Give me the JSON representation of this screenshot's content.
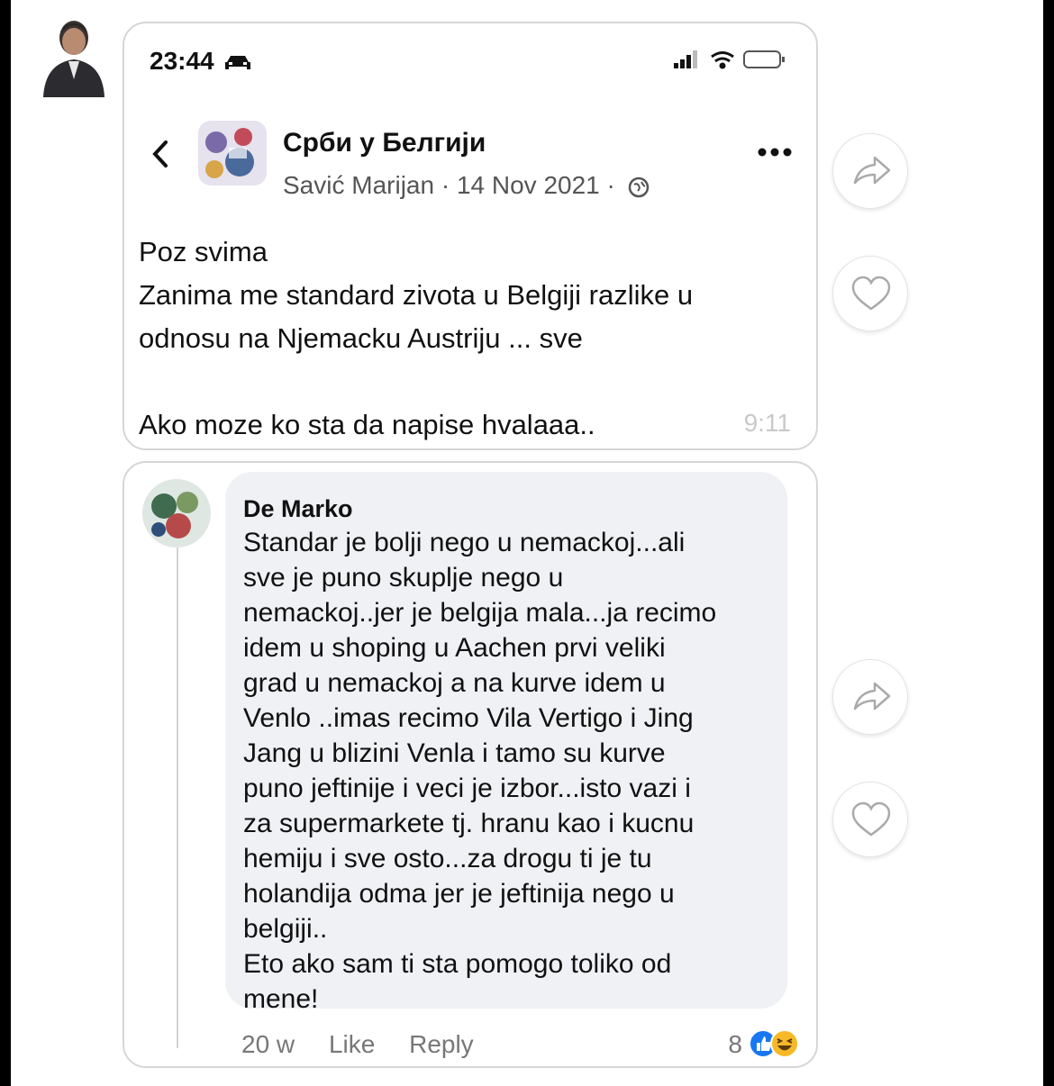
{
  "status_bar": {
    "time": "23:44"
  },
  "post": {
    "group_name": "Срби у Белгији",
    "author": "Savić Marijan",
    "date": "14 Nov 2021",
    "separator": "·",
    "lines": [
      "Poz svima",
      "Zanima me standard zivota u Belgiji razlike u",
      "odnosu na Njemacku Austriju ... sve",
      "",
      "Ako moze ko sta da napise hvalaaa.."
    ],
    "message_time": "9:11"
  },
  "comment": {
    "author": "De Marko",
    "lines": [
      "Standar je bolji nego u nemackoj...ali",
      "sve je puno skuplje nego u",
      "nemackoj..jer je belgija mala...ja recimo",
      "idem u shoping u Aachen prvi veliki",
      "grad u nemackoj a na kurve idem u",
      "Venlo ..imas recimo Vila Vertigo i Jing",
      "Jang u blizini Venla i tamo su kurve",
      "puno jeftinije i veci je izbor...isto vazi i",
      "za supermarkete tj. hranu kao i kucnu",
      "hemiju i sve osto...za drogu ti je tu",
      "holandija odma jer je jeftinija nego u",
      "belgiji..",
      "Eto ako sam ti sta pomogo toliko od",
      "mene!"
    ],
    "age": "20 w",
    "like_label": "Like",
    "reply_label": "Reply",
    "reaction_count": "8",
    "reaction_icons": [
      "like-reaction-icon",
      "haha-reaction-icon"
    ]
  },
  "colors": {
    "background": "#000000",
    "page": "#ffffff",
    "bubble": "#f0f1f4",
    "like_blue": "#1877f2",
    "haha_yellow": "#f7b928"
  }
}
